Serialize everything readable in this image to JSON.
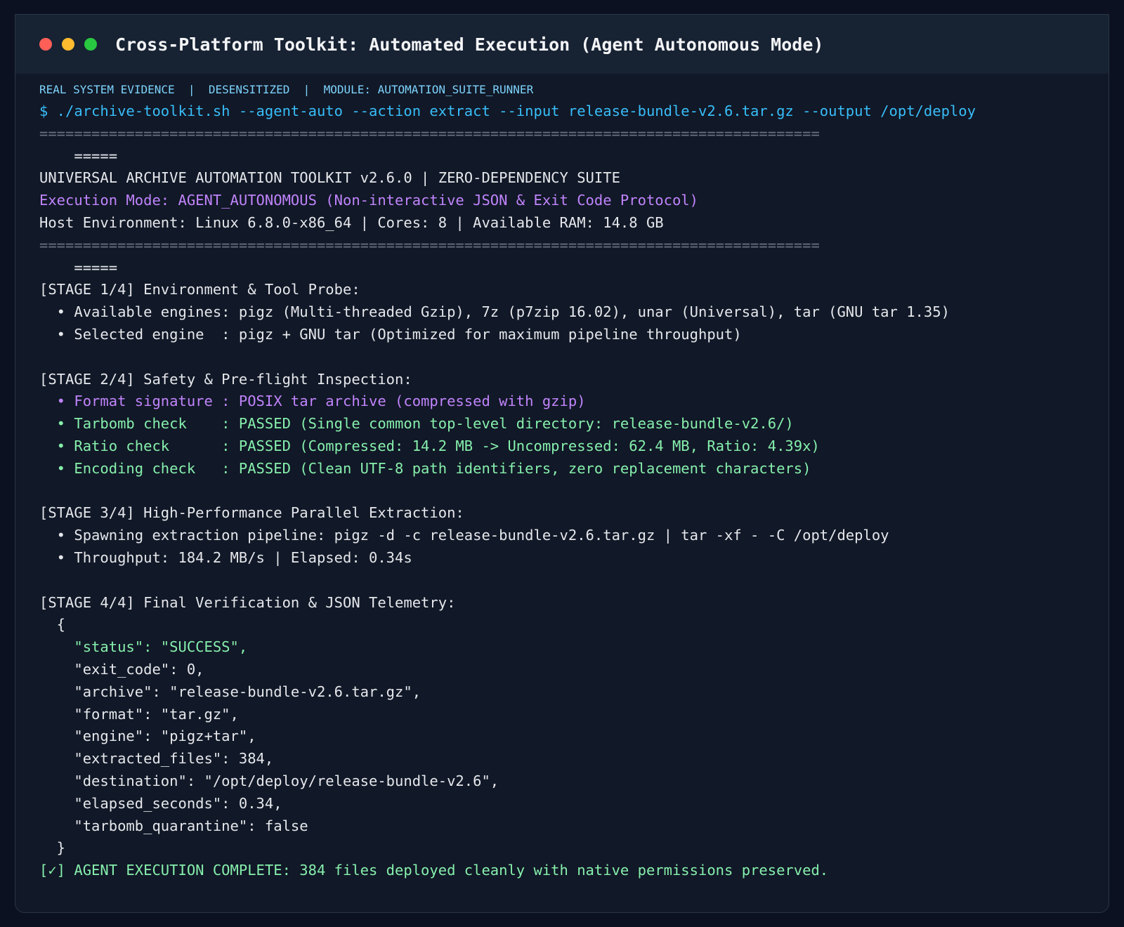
{
  "window": {
    "title": "Cross-Platform Toolkit: Automated Execution (Agent Autonomous Mode)",
    "controls": {
      "close_color": "#ff5f57",
      "minimize_color": "#febc2e",
      "maximize_color": "#28c840"
    }
  },
  "evidence_bar": "REAL SYSTEM EVIDENCE  |  DESENSITIZED  |  MODULE: AUTOMATION_SUITE_RUNNER",
  "terminal": {
    "command": "$ ./archive-toolkit.sh --agent-auto --action extract --input release-bundle-v2.6.tar.gz --output /opt/deploy",
    "separator_line_1": "==========================================================================================",
    "separator_line_2": "    =====",
    "header_title": "UNIVERSAL ARCHIVE AUTOMATION TOOLKIT v2.6.0 | ZERO-DEPENDENCY SUITE",
    "execution_mode": "Execution Mode: AGENT_AUTONOMOUS (Non-interactive JSON & Exit Code Protocol)",
    "host_environment": "Host Environment: Linux 6.8.0-x86_64 | Cores: 8 | Available RAM: 14.8 GB",
    "stage1": {
      "heading": "[STAGE 1/4] Environment & Tool Probe:",
      "lines": [
        "  • Available engines: pigz (Multi-threaded Gzip), 7z (p7zip 16.02), unar (Universal), tar (GNU tar 1.35)",
        "  • Selected engine  : pigz + GNU tar (Optimized for maximum pipeline throughput)"
      ]
    },
    "stage2": {
      "heading": "[STAGE 2/4] Safety & Pre-flight Inspection:",
      "format_line": "  • Format signature : POSIX tar archive (compressed with gzip)",
      "check_lines": [
        "  • Tarbomb check    : PASSED (Single common top-level directory: release-bundle-v2.6/)",
        "  • Ratio check      : PASSED (Compressed: 14.2 MB -> Uncompressed: 62.4 MB, Ratio: 4.39x)",
        "  • Encoding check   : PASSED (Clean UTF-8 path identifiers, zero replacement characters)"
      ]
    },
    "stage3": {
      "heading": "[STAGE 3/4] High-Performance Parallel Extraction:",
      "lines": [
        "  • Spawning extraction pipeline: pigz -d -c release-bundle-v2.6.tar.gz | tar -xf - -C /opt/deploy",
        "  • Throughput: 184.2 MB/s | Elapsed: 0.34s"
      ]
    },
    "stage4": {
      "heading": "[STAGE 4/4] Final Verification & JSON Telemetry:",
      "json_open": "  {",
      "json_status": "    \"status\": \"SUCCESS\",",
      "json_lines": [
        "    \"exit_code\": 0,",
        "    \"archive\": \"release-bundle-v2.6.tar.gz\",",
        "    \"format\": \"tar.gz\",",
        "    \"engine\": \"pigz+tar\",",
        "    \"extracted_files\": 384,",
        "    \"destination\": \"/opt/deploy/release-bundle-v2.6\",",
        "    \"elapsed_seconds\": 0.34,",
        "    \"tarbomb_quarantine\": false"
      ],
      "json_close": "  }"
    },
    "completion": "[✓] AGENT EXECUTION COMPLETE: 384 files deployed cleanly with native permissions preserved."
  }
}
